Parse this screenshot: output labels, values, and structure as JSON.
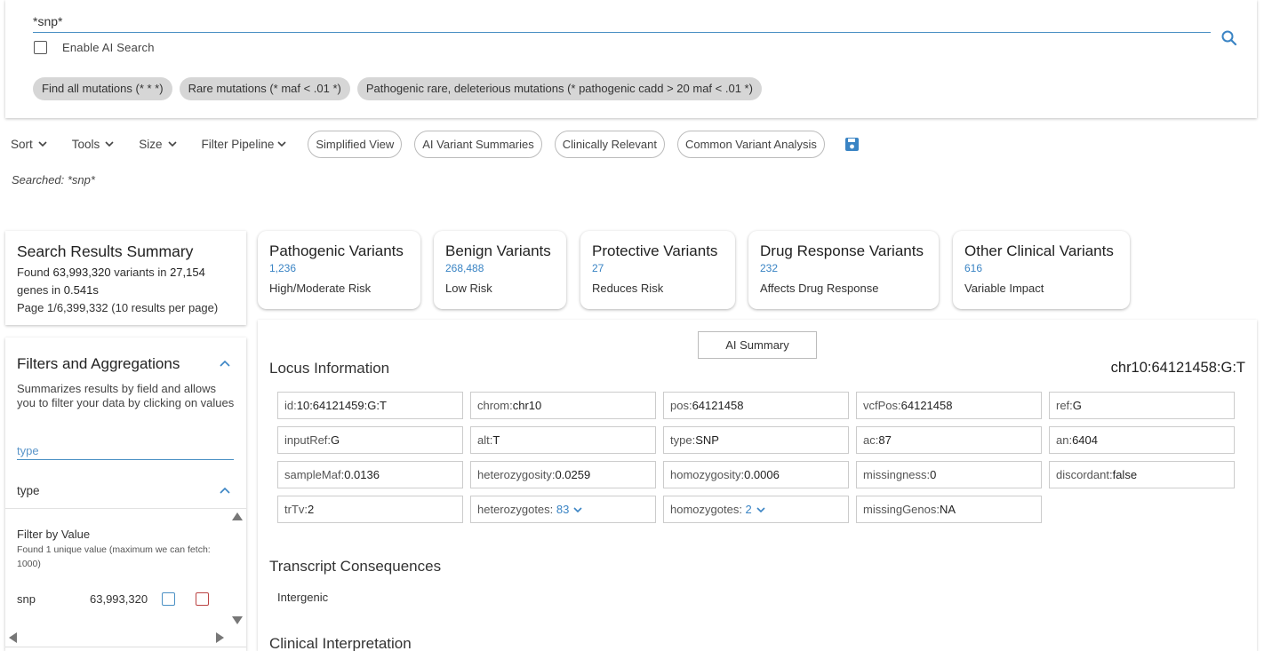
{
  "search": {
    "query": "*snp*",
    "ai_label": "Enable AI Search",
    "chips": [
      "Find all mutations (* * *)",
      "Rare mutations (* maf < .01 *)",
      "Pathogenic rare, deleterious mutations (* pathogenic cadd > 20 maf < .01 *)"
    ]
  },
  "toolbar": {
    "menus": [
      "Sort",
      "Tools",
      "Size",
      "Filter Pipeline"
    ],
    "pills": [
      "Simplified View",
      "AI Variant Summaries",
      "Clinically Relevant",
      "Common Variant Analysis"
    ],
    "save_icon": "save-icon"
  },
  "searched_text": "Searched: *snp*",
  "summary": {
    "title": "Search Results Summary",
    "found_prefix": "Found",
    "variant_count": "63,993,320",
    "variants_in": "variants in",
    "gene_count": "27,154",
    "genes_in": "genes in",
    "time": "0.541s",
    "page_text": "Page 1/6,399,332 (10 results per page)"
  },
  "categories": [
    {
      "title": "Pathogenic Variants",
      "count": "1,236",
      "desc": "High/Moderate Risk"
    },
    {
      "title": "Benign Variants",
      "count": "268,488",
      "desc": "Low Risk"
    },
    {
      "title": "Protective Variants",
      "count": "27",
      "desc": "Reduces Risk"
    },
    {
      "title": "Drug Response Variants",
      "count": "232",
      "desc": "Affects Drug Response"
    },
    {
      "title": "Other Clinical Variants",
      "count": "616",
      "desc": "Variable Impact"
    }
  ],
  "filters": {
    "title": "Filters and Aggregations",
    "desc": "Summarizes results by field and allows you to filter your data by clicking on values",
    "type_placeholder": "type",
    "type_section": "type",
    "filter_by_value": "Filter by Value",
    "found_unique": "Found 1 unique value (maximum we can fetch: 1000)",
    "value_label": "snp",
    "value_count": "63,993,320"
  },
  "detail": {
    "ai_summary_label": "AI Summary",
    "locus_title": "Locus Information",
    "locus_id": "chr10:64121458:G:T",
    "fields": [
      {
        "k": "id:",
        "v": "10:64121459:G:T"
      },
      {
        "k": "chrom:",
        "v": "chr10"
      },
      {
        "k": "pos:",
        "v": "64121458"
      },
      {
        "k": "vcfPos:",
        "v": "64121458"
      },
      {
        "k": "ref:",
        "v": "G"
      },
      {
        "k": "inputRef:",
        "v": "G"
      },
      {
        "k": "alt:",
        "v": "T"
      },
      {
        "k": "type:",
        "v": "SNP"
      },
      {
        "k": "ac:",
        "v": "87"
      },
      {
        "k": "an:",
        "v": "6404"
      },
      {
        "k": "sampleMaf:",
        "v": "0.0136"
      },
      {
        "k": "heterozygosity:",
        "v": "0.0259"
      },
      {
        "k": "homozygosity:",
        "v": "0.0006"
      },
      {
        "k": "missingness:",
        "v": "0"
      },
      {
        "k": "discordant:",
        "v": "false"
      },
      {
        "k": "trTv:",
        "v": "2"
      },
      {
        "k": "heterozygotes: ",
        "v": "83",
        "link": true
      },
      {
        "k": "homozygotes: ",
        "v": "2",
        "link": true
      },
      {
        "k": "missingGenos:",
        "v": "NA"
      }
    ],
    "transcript_title": "Transcript Consequences",
    "transcript_value": "Intergenic",
    "clinical_title": "Clinical Interpretation"
  },
  "colors": {
    "accent": "#3a84c4",
    "save": "#3a84c4",
    "reject": "#bb4444"
  }
}
